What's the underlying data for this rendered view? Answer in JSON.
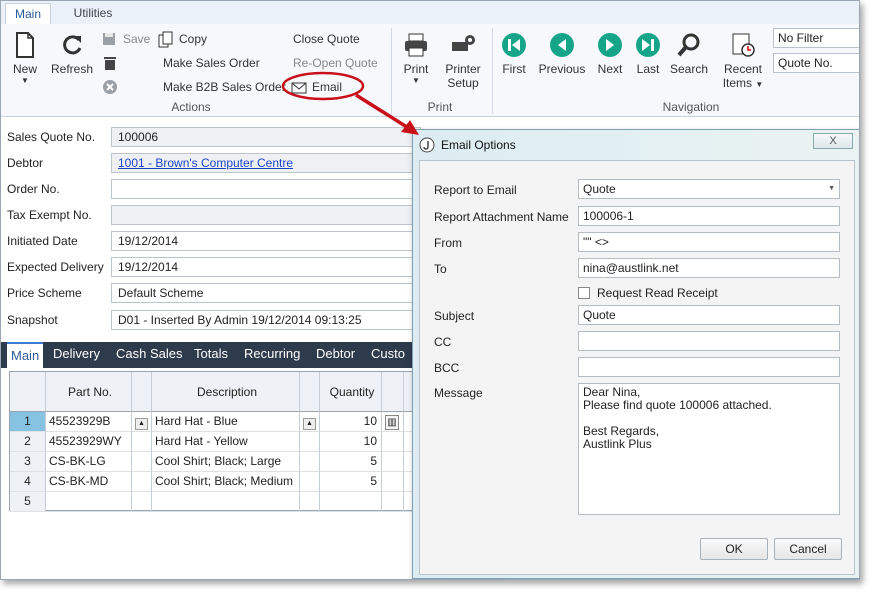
{
  "ribbon_tabs": [
    "Main",
    "Utilities"
  ],
  "actions": {
    "new": "New",
    "refresh": "Refresh",
    "save": "Save",
    "copy": "Copy",
    "make_sales_order": "Make Sales Order",
    "make_b2b_sales_order": "Make B2B Sales Order",
    "close_quote": "Close Quote",
    "reopen_quote": "Re-Open Quote",
    "email": "Email",
    "group": "Actions"
  },
  "print": {
    "print": "Print",
    "printer_setup_1": "Printer",
    "printer_setup_2": "Setup",
    "group": "Print"
  },
  "navigation": {
    "first": "First",
    "previous": "Previous",
    "next": "Next",
    "last": "Last",
    "search": "Search",
    "recent_1": "Recent",
    "recent_2": "Items",
    "group": "Navigation"
  },
  "filters": {
    "filter": "No Filter",
    "sort": "Quote No."
  },
  "form": {
    "sales_quote_no": {
      "label": "Sales Quote No.",
      "value": "100006"
    },
    "debtor": {
      "label": "Debtor",
      "value": "1001 - Brown's Computer Centre"
    },
    "order_no": {
      "label": "Order No.",
      "value": ""
    },
    "tax_exempt_no": {
      "label": "Tax Exempt No.",
      "value": ""
    },
    "initiated_date": {
      "label": "Initiated Date",
      "value": "19/12/2014"
    },
    "expected_delivery": {
      "label": "Expected Delivery",
      "value": "19/12/2014"
    },
    "price_scheme": {
      "label": "Price Scheme",
      "value": "Default Scheme"
    },
    "snapshot": {
      "label": "Snapshot",
      "value": "D01 - Inserted By Admin 19/12/2014 09:13:25"
    }
  },
  "subtabs": [
    "Main",
    "Delivery",
    "Cash Sales",
    "Totals",
    "Recurring",
    "Debtor",
    "Custo"
  ],
  "grid": {
    "columns": [
      "Part No.",
      "Description",
      "Quantity"
    ],
    "rows": [
      {
        "n": "1",
        "part": "45523929B",
        "desc": "Hard Hat - Blue",
        "qty": "10"
      },
      {
        "n": "2",
        "part": "45523929WY",
        "desc": "Hard Hat - Yellow",
        "qty": "10"
      },
      {
        "n": "3",
        "part": "CS-BK-LG",
        "desc": "Cool Shirt; Black; Large",
        "qty": "5"
      },
      {
        "n": "4",
        "part": "CS-BK-MD",
        "desc": "Cool Shirt; Black; Medium",
        "qty": "5"
      },
      {
        "n": "5",
        "part": "",
        "desc": "",
        "qty": ""
      }
    ]
  },
  "dialog": {
    "title": "Email Options",
    "close": "X",
    "report_to_email": {
      "label": "Report to Email",
      "value": "Quote"
    },
    "attachment_name": {
      "label": "Report Attachment Name",
      "value": "100006-1"
    },
    "from": {
      "label": "From",
      "value": "\"\" <>"
    },
    "to": {
      "label": "To",
      "value": "nina@austlink.net"
    },
    "read_receipt": "Request Read Receipt",
    "subject": {
      "label": "Subject",
      "value": "Quote"
    },
    "cc": {
      "label": "CC",
      "value": ""
    },
    "bcc": {
      "label": "BCC",
      "value": ""
    },
    "message": {
      "label": "Message",
      "lines": [
        "Dear Nina,",
        "Please find quote 100006 attached.",
        "",
        "Best Regards,",
        "Austlink Plus"
      ]
    },
    "ok": "OK",
    "cancel": "Cancel"
  },
  "colors": {
    "accent": "#2b5a9b",
    "nav_green": "#17a58a",
    "callout_red": "#c8101b"
  }
}
